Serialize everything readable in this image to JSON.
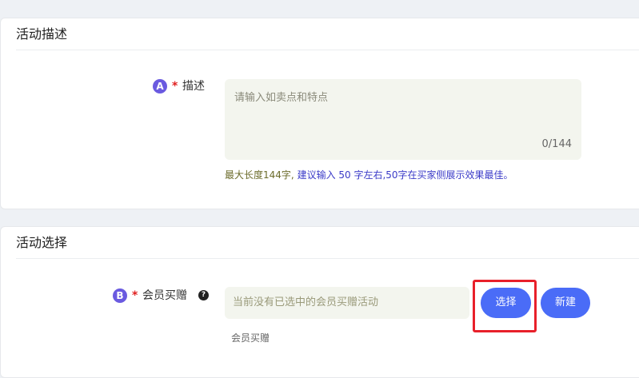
{
  "description_section": {
    "title": "活动描述",
    "marker": "A",
    "required_mark": "*",
    "label": "描述",
    "placeholder": "请输入如卖点和特点",
    "counter": "0/144",
    "hint_gray": "最大长度144字,",
    "hint_blue": "建议输入 50 字左右,50字在买家侧展示效果最佳。"
  },
  "select_section": {
    "title": "活动选择",
    "marker": "B",
    "required_mark": "*",
    "label": "会员买赠",
    "help_glyph": "?",
    "placeholder": "当前没有已选中的会员买赠活动",
    "select_label": "选择",
    "new_label": "新建",
    "subtext": "会员买赠"
  },
  "colors": {
    "primary": "#4a6cf7",
    "marker": "#6a5ae0",
    "highlight_box": "#e8202a",
    "required": "#e02020"
  },
  "icons": {
    "help": "question-circle-icon"
  }
}
